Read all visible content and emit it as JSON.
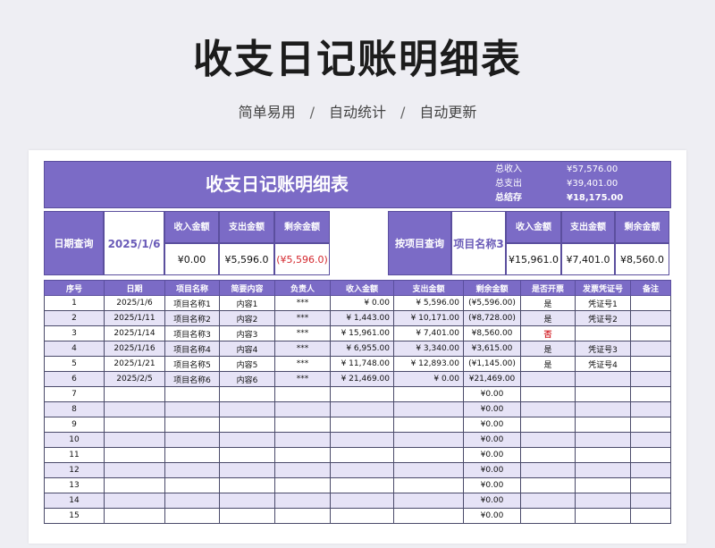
{
  "page": {
    "title": "收支日记账明细表",
    "subtitle": [
      "简单易用",
      "自动统计",
      "自动更新"
    ],
    "subtitle_sep": "/"
  },
  "banner": {
    "title": "收支日记账明细表",
    "summary": [
      {
        "label": "总收入",
        "value": "¥57,576.00"
      },
      {
        "label": "总支出",
        "value": "¥39,401.00"
      },
      {
        "label": "总结存",
        "value": "¥18,175.00"
      }
    ]
  },
  "date_query": {
    "label": "日期查询",
    "value": "2025/1/6",
    "headers": [
      "收入金额",
      "支出金额",
      "剩余金额"
    ],
    "values": [
      "¥0.00",
      "¥5,596.0",
      "(¥5,596.0)"
    ]
  },
  "item_query": {
    "label": "按项目查询",
    "value": "项目名称3",
    "headers": [
      "收入金额",
      "支出金额",
      "剩余金额"
    ],
    "values": [
      "¥15,961.0",
      "¥7,401.0",
      "¥8,560.0"
    ]
  },
  "table": {
    "columns": [
      "序号",
      "日期",
      "项目名称",
      "简要内容",
      "负责人",
      "收入金额",
      "支出金额",
      "剩余金额",
      "是否开票",
      "发票凭证号",
      "备注"
    ],
    "rows": [
      [
        "1",
        "2025/1/6",
        "项目名称1",
        "内容1",
        "***",
        "¥ 0.00",
        "¥ 5,596.00",
        "(¥5,596.00)",
        "是",
        "凭证号1",
        ""
      ],
      [
        "2",
        "2025/1/11",
        "项目名称2",
        "内容2",
        "***",
        "¥ 1,443.00",
        "¥ 10,171.00",
        "(¥8,728.00)",
        "是",
        "凭证号2",
        ""
      ],
      [
        "3",
        "2025/1/14",
        "项目名称3",
        "内容3",
        "***",
        "¥ 15,961.00",
        "¥ 7,401.00",
        "¥8,560.00",
        "否",
        "",
        ""
      ],
      [
        "4",
        "2025/1/16",
        "项目名称4",
        "内容4",
        "***",
        "¥ 6,955.00",
        "¥ 3,340.00",
        "¥3,615.00",
        "是",
        "凭证号3",
        ""
      ],
      [
        "5",
        "2025/1/21",
        "项目名称5",
        "内容5",
        "***",
        "¥ 11,748.00",
        "¥ 12,893.00",
        "(¥1,145.00)",
        "是",
        "凭证号4",
        ""
      ],
      [
        "6",
        "2025/2/5",
        "项目名称6",
        "内容6",
        "***",
        "¥ 21,469.00",
        "¥ 0.00",
        "¥21,469.00",
        "",
        "",
        ""
      ],
      [
        "7",
        "",
        "",
        "",
        "",
        "",
        "",
        "¥0.00",
        "",
        "",
        ""
      ],
      [
        "8",
        "",
        "",
        "",
        "",
        "",
        "",
        "¥0.00",
        "",
        "",
        ""
      ],
      [
        "9",
        "",
        "",
        "",
        "",
        "",
        "",
        "¥0.00",
        "",
        "",
        ""
      ],
      [
        "10",
        "",
        "",
        "",
        "",
        "",
        "",
        "¥0.00",
        "",
        "",
        ""
      ],
      [
        "11",
        "",
        "",
        "",
        "",
        "",
        "",
        "¥0.00",
        "",
        "",
        ""
      ],
      [
        "12",
        "",
        "",
        "",
        "",
        "",
        "",
        "¥0.00",
        "",
        "",
        ""
      ],
      [
        "13",
        "",
        "",
        "",
        "",
        "",
        "",
        "¥0.00",
        "",
        "",
        ""
      ],
      [
        "14",
        "",
        "",
        "",
        "",
        "",
        "",
        "¥0.00",
        "",
        "",
        ""
      ],
      [
        "15",
        "",
        "",
        "",
        "",
        "",
        "",
        "¥0.00",
        "",
        "",
        ""
      ]
    ]
  },
  "colors": {
    "header_purple": "#7b6bc6",
    "alt_row": "#e6e3f6",
    "negative_red": "#d4282e"
  }
}
